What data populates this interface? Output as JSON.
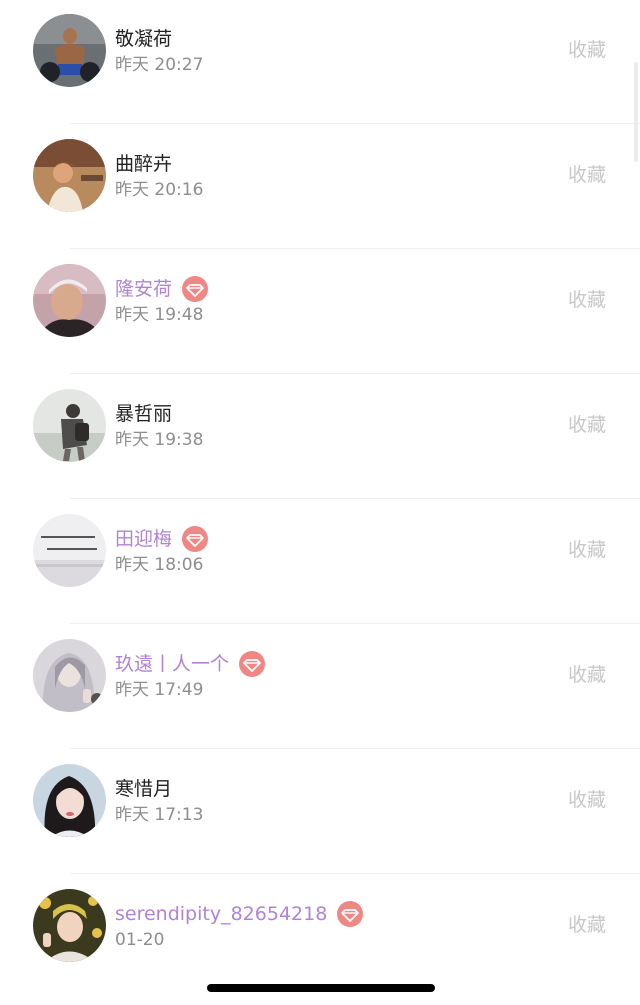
{
  "friends": [
    {
      "name": "敬凝荷",
      "time": "昨天 20:27",
      "vip": false,
      "action": "收藏",
      "avatar": "avatar-man-shirtless-gym"
    },
    {
      "name": "曲醉卉",
      "time": "昨天 20:16",
      "vip": false,
      "action": "收藏",
      "avatar": "avatar-person-outdoor-warm"
    },
    {
      "name": "隆安荷",
      "time": "昨天 19:48",
      "vip": true,
      "action": "收藏",
      "avatar": "avatar-person-cap-selfie"
    },
    {
      "name": "暴哲丽",
      "time": "昨天 19:38",
      "vip": false,
      "action": "收藏",
      "avatar": "avatar-person-backpack-street"
    },
    {
      "name": "田迎梅",
      "time": "昨天 18:06",
      "vip": true,
      "action": "收藏",
      "avatar": "avatar-text-seascape"
    },
    {
      "name": "玖遠丨人一个",
      "time": "昨天 17:49",
      "vip": true,
      "action": "收藏",
      "avatar": "avatar-girl-peace-sign"
    },
    {
      "name": "寒惜月",
      "time": "昨天 17:13",
      "vip": false,
      "action": "收藏",
      "avatar": "avatar-girl-portrait"
    },
    {
      "name": "serendipity_82654218",
      "time": "01-20",
      "vip": true,
      "action": "收藏",
      "avatar": "avatar-boy-peace-sign"
    }
  ],
  "colors": {
    "name_default": "#222222",
    "name_vip": "#b083d6",
    "vip_badge": "#ef8884",
    "time": "#8e8e8e",
    "action": "#c8c8c8"
  },
  "icons": {
    "vip_badge": "diamond-icon"
  }
}
